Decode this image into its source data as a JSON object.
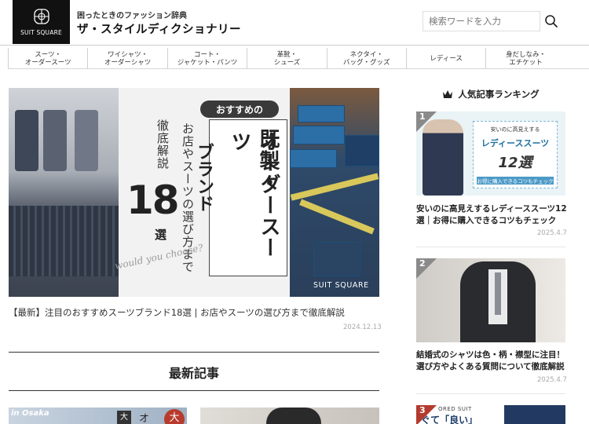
{
  "header": {
    "logo_text": "SUIT SQUARE",
    "tagline": "困ったときのファッション辞典",
    "site_title": "ザ・スタイルディクショナリー",
    "search_placeholder": "検索ワードを入力",
    "search_icon": "magnifier"
  },
  "nav": {
    "items": [
      {
        "label": "スーツ・\nオーダースーツ"
      },
      {
        "label": "ワイシャツ・\nオーダーシャツ"
      },
      {
        "label": "コート・\nジャケット・パンツ"
      },
      {
        "label": "革靴・\nシューズ"
      },
      {
        "label": "ネクタイ・\nバッグ・グッズ"
      },
      {
        "label": "レディース"
      },
      {
        "label": "身だしなみ・\nエチケット"
      }
    ]
  },
  "hero": {
    "badge": "おすすめの",
    "headline_1": "既製・",
    "headline_2": "オーダースーツ",
    "headline_3": "ブランド",
    "sub_1": "お店やスーツの選び方まで",
    "sub_2": "徹底解説",
    "number": "18",
    "counter": "選",
    "script_text": "would you choose?",
    "brand": "SUIT SQUARE",
    "caption": "【最新】注目のおすすめスーツブランド18選 | お店やスーツの選び方まで徹底解説",
    "date": "2024.12.13"
  },
  "latest": {
    "title": "最新記事",
    "thumb1_tag": "in Osaka",
    "thumb1_k1": "大",
    "thumb1_k2": "オ",
    "thumb1_k3": "大"
  },
  "ranking": {
    "title": "人気記事ランキング",
    "items": [
      {
        "rank": "1",
        "img_line1": "安いのに高見えする",
        "img_line2": "レディーススーツ",
        "img_line3": "12選",
        "img_line4": "お得に購入できるコツもチェック",
        "title": "安いのに高見えするレディーススーツ12選｜お得に購入できるコツもチェック",
        "date": "2025.4.7"
      },
      {
        "rank": "2",
        "title": "結婚式のシャツは色・柄・襟型に注目！選び方やよくある質問について徹底解説",
        "date": "2025.4.7"
      },
      {
        "rank": "3",
        "img_line1": "ORED SUIT",
        "img_line2": "ぐて「良い」"
      }
    ]
  },
  "colors": {
    "logo_bg": "#111111",
    "accent_blue": "#1f6f9e",
    "rank_badge": "#8a8a8a"
  }
}
